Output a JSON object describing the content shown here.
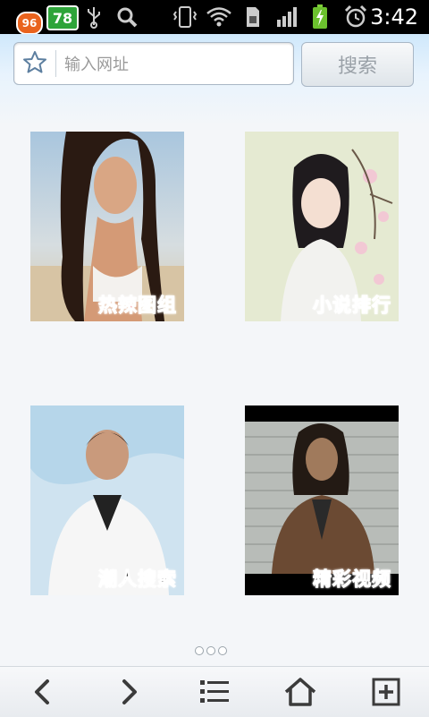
{
  "status_bar": {
    "badge_count": "96",
    "notification_count": "78",
    "time": "3:42",
    "icons": [
      "usb-icon",
      "search-icon",
      "vibrate-icon",
      "wifi-icon",
      "sim-icon",
      "signal-icon",
      "battery-charging-icon",
      "alarm-icon"
    ]
  },
  "search": {
    "url_placeholder": "输入网址",
    "search_button_label": "搜索"
  },
  "tiles": [
    {
      "label": "热辣图组",
      "label_color": "#e8242a"
    },
    {
      "label": "小说排行",
      "label_color": "#2ea43a"
    },
    {
      "label": "潮人搜索",
      "label_color": "#111111"
    },
    {
      "label": "精彩视频",
      "label_color": "#111111"
    }
  ],
  "pager": {
    "pages": 3,
    "current": 1
  },
  "toolbar": {
    "icons": [
      "back-icon",
      "forward-icon",
      "menu-icon",
      "home-icon",
      "new-tab-icon"
    ]
  },
  "colors": {
    "accent": "#cfe8fb",
    "status_bar": "#000000"
  }
}
